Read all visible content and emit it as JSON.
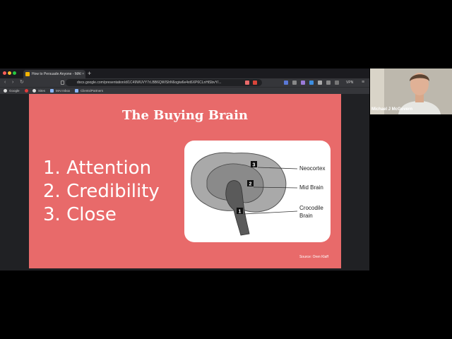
{
  "browser": {
    "tab_title": "How to Persuade Anyone - MAI",
    "tab_close": "×",
    "new_tab": "+",
    "url": "docs.google.com/presentation/d/1C49WUVY7rLBB6QWIShN6ogiw6e4xt6XP6CLnHiSbvY/...",
    "vpn_label": "VPN",
    "nav_back": "‹",
    "nav_forward": "›",
    "nav_reload": "↻",
    "bookmarks": [
      {
        "label": "Google"
      },
      {
        "label": "Sites"
      },
      {
        "label": "MAI Inbox"
      },
      {
        "label": "Clients/Partners"
      }
    ]
  },
  "slide": {
    "title": "The Buying Brain",
    "list": [
      "1. Attention",
      "2. Credibility",
      "3. Close"
    ],
    "diagram": {
      "labels": {
        "neocortex": "Neocortex",
        "mid_brain": "Mid Brain",
        "crocodile": "Crocodile",
        "crocodile_2": "Brain"
      },
      "markers": [
        "1",
        "2",
        "3"
      ]
    },
    "source": "Source: Oren Klaff"
  },
  "video": {
    "participant_name": "Michael J McGovern"
  },
  "colors": {
    "slide_bg": "#e86a6a",
    "browser_bg": "#202124",
    "toolbar_bg": "#35363a"
  }
}
